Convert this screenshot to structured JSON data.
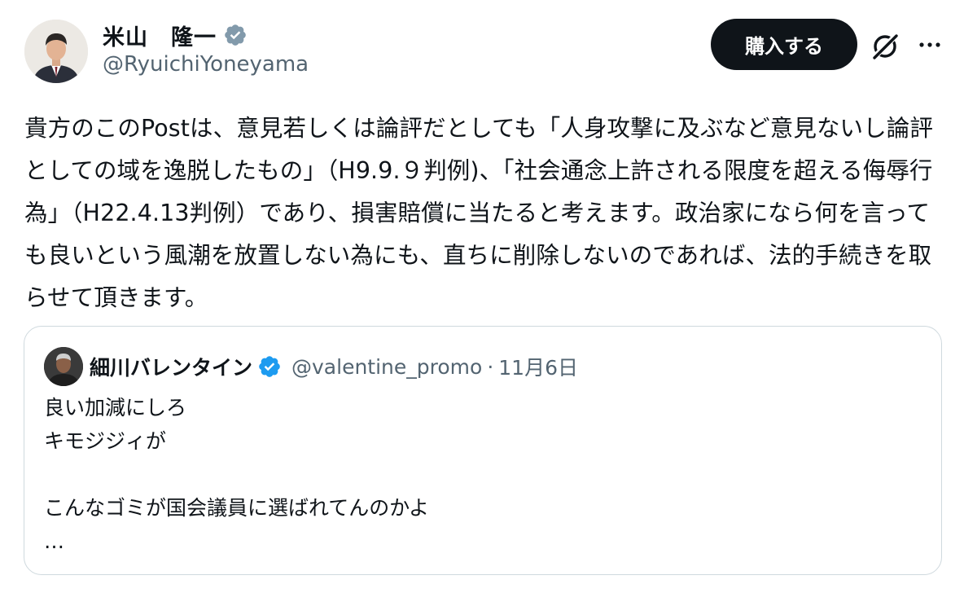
{
  "post": {
    "author": {
      "name": "米山　隆一",
      "handle": "@RyuichiYoneyama",
      "verified_badge_color": "#829aab"
    },
    "subscribe_label": "購入する",
    "icons": {
      "grok": "grok-slash-icon",
      "more": "more-horizontal-icon",
      "verified": "verified-badge-icon"
    },
    "text": "貴方のこのPostは、意見若しくは論評だとしても「人身攻撃に及ぶなど意見ないし論評としての域を逸脱したもの」（H9.9.９判例)、「社会通念上許される限度を超える侮辱行為」（H22.4.13判例）であり、損害賠償に当たると考えます。政治家になら何を言っても良いという風潮を放置しない為にも、直ちに削除しないのであれば、法的手続きを取らせて頂きます。",
    "quote": {
      "name": "細川バレンタイン",
      "handle": "@valentine_promo",
      "separator": "·",
      "date": "11月6日",
      "verified_badge_color": "#1d9bf0",
      "lines": [
        "良い加減にしろ",
        "キモジジィが",
        "",
        "こんなゴミが国会議員に選ばれてんのかよ",
        "…"
      ]
    }
  },
  "colors": {
    "text": "#0f1419",
    "secondary": "#536471",
    "border": "#cfd9de",
    "button_bg": "#0f1419"
  }
}
